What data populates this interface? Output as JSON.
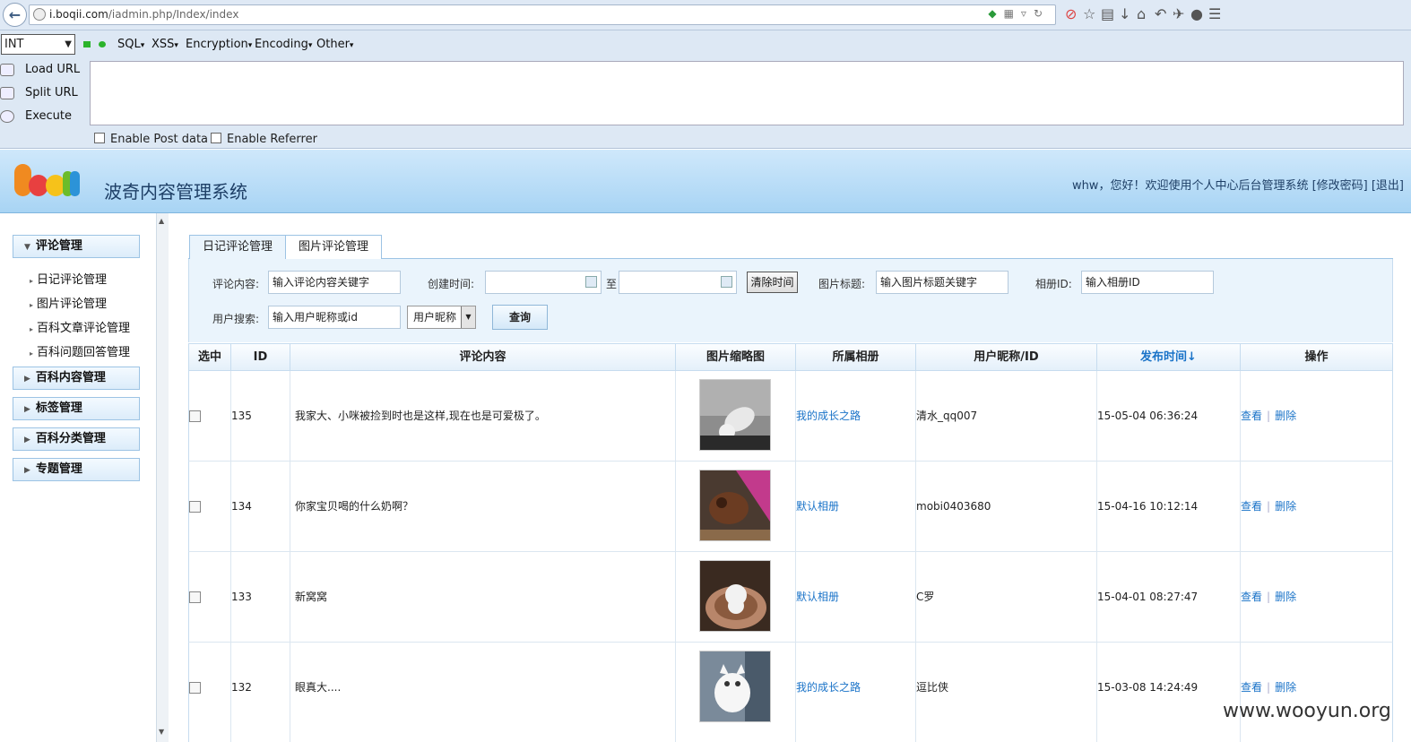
{
  "browser": {
    "url_host": "i.boqii.com",
    "url_path": "/iadmin.php/Index/index"
  },
  "hackbar": {
    "select_value": "INT",
    "menus": [
      "SQL",
      "XSS",
      "Encryption",
      "Encoding",
      "Other"
    ],
    "actions": [
      "Load URL",
      "Split URL",
      "Execute"
    ],
    "checks": [
      "Enable Post data",
      "Enable Referrer"
    ]
  },
  "header": {
    "site_title": "波奇内容管理系统",
    "user_greeting": "whw，您好！欢迎使用个人中心后台管理系统 [修改密码] [退出]"
  },
  "sidebar": {
    "sections": [
      {
        "label": "评论管理",
        "expanded": true,
        "items": [
          "日记评论管理",
          "图片评论管理",
          "百科文章评论管理",
          "百科问题回答管理"
        ]
      },
      {
        "label": "百科内容管理"
      },
      {
        "label": "标签管理"
      },
      {
        "label": "百科分类管理"
      },
      {
        "label": "专题管理"
      }
    ]
  },
  "tabs": [
    "日记评论管理",
    "图片评论管理"
  ],
  "filters": {
    "comment_label": "评论内容:",
    "comment_value": "输入评论内容关键字",
    "created_label": "创建时间:",
    "to_label": "至",
    "clear_button": "清除时间",
    "image_title_label": "图片标题:",
    "image_title_value": "输入图片标题关键字",
    "album_id_label": "相册ID:",
    "album_id_value": "输入相册ID",
    "user_label": "用户搜索:",
    "user_value": "输入用户昵称或id",
    "user_select": "用户昵称",
    "search_button": "查询"
  },
  "table": {
    "headers": [
      "选中",
      "ID",
      "评论内容",
      "图片缩略图",
      "所属相册",
      "用户昵称/ID",
      "发布时间↓",
      "操作"
    ],
    "rows": [
      {
        "id": "135",
        "comment": "我家大、小咪被捡到时也是这样,现在也是可爱极了。",
        "album": "我的成长之路",
        "user": "清水_qq007",
        "time": "15-05-04 06:36:24",
        "view": "查看",
        "delete": "删除"
      },
      {
        "id": "134",
        "comment": "你家宝贝喝的什么奶啊？",
        "album": "默认相册",
        "user": "mobi0403680",
        "time": "15-04-16 10:12:14",
        "view": "查看",
        "delete": "删除"
      },
      {
        "id": "133",
        "comment": "新窝窝",
        "album": "默认相册",
        "user": "C罗",
        "time": "15-04-01 08:27:47",
        "view": "查看",
        "delete": "删除"
      },
      {
        "id": "132",
        "comment": "眼真大....",
        "album": "我的成长之路",
        "user": "逗比侠",
        "time": "15-03-08 14:24:49",
        "view": "查看",
        "delete": "删除"
      }
    ]
  },
  "watermark": "www.wooyun.org"
}
